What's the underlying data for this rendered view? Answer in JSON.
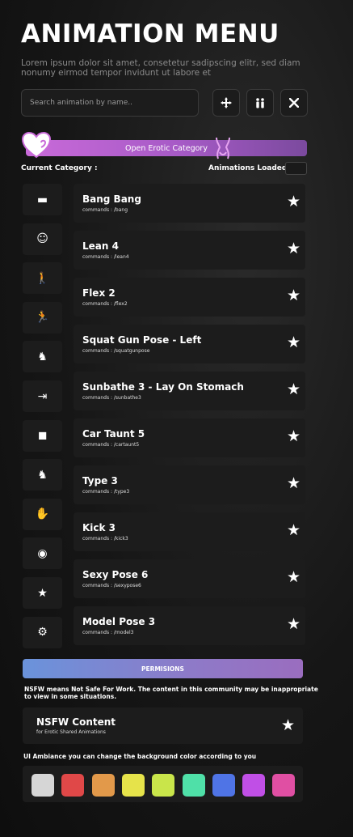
{
  "header": {
    "title": "ANIMATION MENU",
    "description": "Lorem ipsum dolor sit amet, consetetur sadipscing elitr, sed diam nonumy eirmod tempor invidunt ut labore et"
  },
  "search": {
    "placeholder": "Search animation by name.."
  },
  "toolbar": {
    "move_icon": "move-icon",
    "walk_icon": "people-icon",
    "close_icon": "close-icon"
  },
  "category": {
    "open_label": "Open Erotic Category",
    "current_label": "Current Category :",
    "loaded_label": "Animations Loaded"
  },
  "sidebar": [
    {
      "icon": "card-icon",
      "glyph": "▬"
    },
    {
      "icon": "smiley-icon",
      "glyph": "☺"
    },
    {
      "icon": "walk-icon",
      "glyph": "🚶"
    },
    {
      "icon": "wave-icon",
      "glyph": "🏃"
    },
    {
      "icon": "dance-icon",
      "glyph": "♞"
    },
    {
      "icon": "run-door-icon",
      "glyph": "⇥"
    },
    {
      "icon": "box-icon",
      "glyph": "◼"
    },
    {
      "icon": "dog-icon",
      "glyph": "♞"
    },
    {
      "icon": "hand-icon",
      "glyph": "✋"
    },
    {
      "icon": "bear-icon",
      "glyph": "◉"
    },
    {
      "icon": "star-icon",
      "glyph": "★"
    },
    {
      "icon": "settings-icon",
      "glyph": "⚙"
    }
  ],
  "animations": [
    {
      "name": "Bang Bang",
      "command": "commands : /bang"
    },
    {
      "name": "Lean 4",
      "command": "commands : /lean4"
    },
    {
      "name": "Flex 2",
      "command": "commands : /flex2"
    },
    {
      "name": "Squat Gun Pose - Left",
      "command": "commands : /squatgunpose"
    },
    {
      "name": "Sunbathe 3 - Lay On Stomach",
      "command": "commands : /sunbathe3"
    },
    {
      "name": "Car Taunt 5",
      "command": "commands : /cartaunt5"
    },
    {
      "name": "Type 3",
      "command": "commands : /type3"
    },
    {
      "name": "Kick 3",
      "command": "commands : /kick3"
    },
    {
      "name": "Sexy Pose 6",
      "command": "commands : /sexypose6"
    },
    {
      "name": "Model Pose 3",
      "command": "commands : /model3"
    }
  ],
  "permissions": {
    "button_label": "PERMISIONS",
    "note": "NSFW means Not Safe For Work. The content in this community may be inappropriate to view in some situations.",
    "nsfw_title": "NSFW Content",
    "nsfw_subtitle": "for Erotic Shared Animations"
  },
  "ambiance": {
    "label": "UI Ambiance you can change the background color according to you",
    "colors": [
      "#d6d6d6",
      "#e04848",
      "#e2994a",
      "#e6e34a",
      "#c9e54a",
      "#4fe0a8",
      "#4f74e6",
      "#c04fe6",
      "#e04fa3"
    ]
  }
}
